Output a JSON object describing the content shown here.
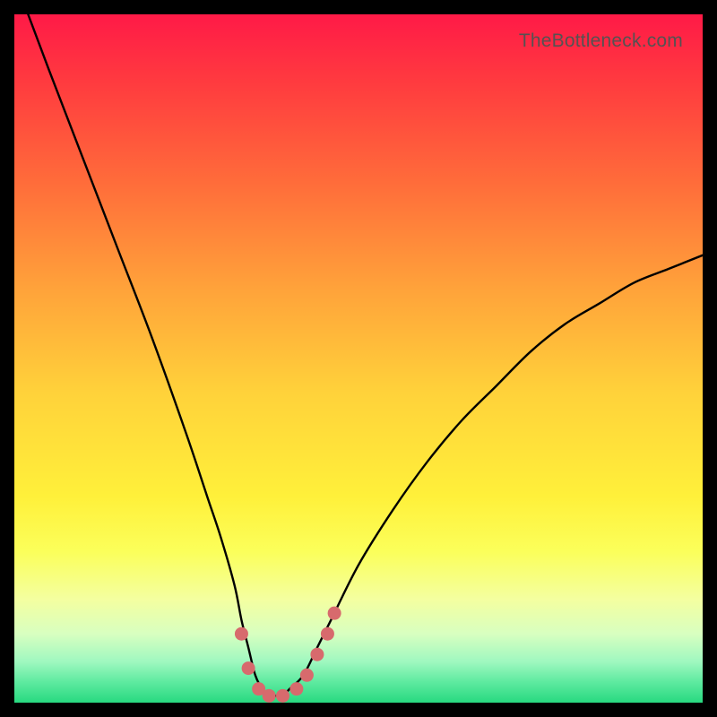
{
  "watermark": "TheBottleneck.com",
  "chart_data": {
    "type": "line",
    "title": "",
    "xlabel": "",
    "ylabel": "",
    "xlim": [
      0,
      100
    ],
    "ylim": [
      0,
      100
    ],
    "grid": false,
    "series": [
      {
        "name": "main-curve",
        "color_note": "black line over rainbow gradient background; value read as vertical position (0=bottom green, 100=top red)",
        "x": [
          2,
          5,
          10,
          15,
          20,
          25,
          28,
          30,
          32,
          33,
          34,
          35,
          36,
          37,
          38,
          39,
          40,
          42,
          44,
          46,
          50,
          55,
          60,
          65,
          70,
          75,
          80,
          85,
          90,
          95,
          100
        ],
        "values": [
          100,
          92,
          79,
          66,
          53,
          39,
          30,
          24,
          17,
          12,
          8,
          4,
          2,
          1,
          1,
          1,
          2,
          4,
          8,
          12,
          20,
          28,
          35,
          41,
          46,
          51,
          55,
          58,
          61,
          63,
          65
        ]
      },
      {
        "name": "highlight-dots",
        "color": "#d76a6d",
        "x": [
          33,
          34,
          35.5,
          37,
          39,
          41,
          42.5,
          44,
          45.5,
          46.5
        ],
        "values": [
          10,
          5,
          2,
          1,
          1,
          2,
          4,
          7,
          10,
          13
        ]
      }
    ],
    "gradient_stops": [
      {
        "pos": 0.0,
        "color": "#ff1a47"
      },
      {
        "pos": 0.1,
        "color": "#ff3b3f"
      },
      {
        "pos": 0.25,
        "color": "#ff6e3a"
      },
      {
        "pos": 0.4,
        "color": "#ffa33a"
      },
      {
        "pos": 0.55,
        "color": "#ffd23a"
      },
      {
        "pos": 0.7,
        "color": "#fff03a"
      },
      {
        "pos": 0.78,
        "color": "#fbff5a"
      },
      {
        "pos": 0.85,
        "color": "#f4ffa0"
      },
      {
        "pos": 0.9,
        "color": "#d8ffc0"
      },
      {
        "pos": 0.94,
        "color": "#a0f8c0"
      },
      {
        "pos": 0.97,
        "color": "#5eeaa0"
      },
      {
        "pos": 1.0,
        "color": "#28d980"
      }
    ]
  }
}
